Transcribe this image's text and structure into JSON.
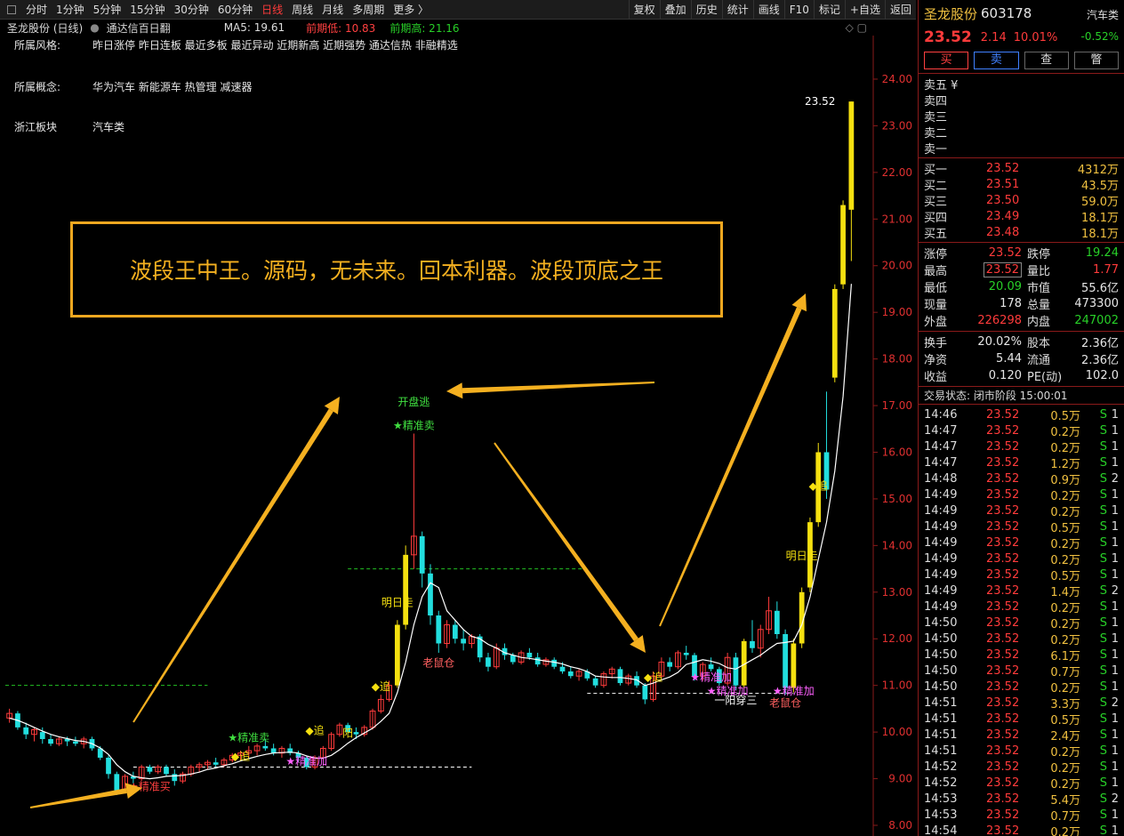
{
  "toolbar": {
    "periods": [
      "分时",
      "1分钟",
      "5分钟",
      "15分钟",
      "30分钟",
      "60分钟",
      "日线",
      "周线",
      "月线",
      "多周期",
      "更多 〉"
    ],
    "active_index": 6,
    "right": [
      "复权",
      "叠加",
      "历史",
      "统计",
      "画线",
      "F10",
      "标记",
      "+自选",
      "返回"
    ]
  },
  "info": {
    "title": "圣龙股份 (日线)",
    "indicator": "通达信百日翻",
    "ma5": "MA5: 19.61",
    "prev_low": "前期低: 10.83",
    "prev_high": "前期高: 21.16"
  },
  "tags": [
    {
      "label": "所属风格:",
      "value": "昨日涨停 昨日连板 最近多板 最近异动 近期新高 近期强势 通达信热 非融精选"
    },
    {
      "label": "所属概念:",
      "value": "华为汽车 新能源车 热管理 减速器"
    },
    {
      "label": "浙江板块",
      "value": "汽车类"
    }
  ],
  "banner": "波段王中王。源码，无未来。回本利器。波段顶底之王",
  "colors": {
    "up": "#ff3b3b",
    "down": "#22dede",
    "ma": "#ffffff",
    "signal_yellow": "#f5e010",
    "arrow": "#f4b020",
    "grid_axis": "#8a1a1a"
  },
  "chart_data": {
    "type": "candlestick",
    "ylim": [
      8.0,
      24.4
    ],
    "yticks": [
      8.0,
      9.0,
      10.0,
      11.0,
      12.0,
      13.0,
      14.0,
      15.0,
      16.0,
      17.0,
      18.0,
      19.0,
      20.0,
      21.0,
      22.0,
      23.0,
      24.0
    ],
    "candles": [
      [
        10.3,
        10.5,
        10.2,
        10.4
      ],
      [
        10.4,
        10.45,
        10.05,
        10.1
      ],
      [
        10.1,
        10.2,
        9.85,
        9.95
      ],
      [
        9.95,
        10.1,
        9.8,
        10.05
      ],
      [
        10.0,
        10.1,
        9.75,
        9.85
      ],
      [
        9.85,
        9.95,
        9.7,
        9.75
      ],
      [
        9.75,
        9.9,
        9.7,
        9.85
      ],
      [
        9.85,
        9.9,
        9.7,
        9.8
      ],
      [
        9.8,
        9.9,
        9.7,
        9.75
      ],
      [
        9.75,
        9.9,
        9.65,
        9.85
      ],
      [
        9.85,
        9.9,
        9.6,
        9.65
      ],
      [
        9.65,
        9.7,
        9.4,
        9.45
      ],
      [
        9.45,
        9.5,
        9.0,
        9.1
      ],
      [
        9.1,
        9.15,
        8.65,
        8.75
      ],
      [
        8.75,
        9.1,
        8.7,
        9.05
      ],
      [
        9.05,
        9.15,
        8.9,
        9.0
      ],
      [
        9.0,
        9.3,
        8.95,
        9.25
      ],
      [
        9.25,
        9.3,
        9.1,
        9.15
      ],
      [
        9.15,
        9.3,
        9.1,
        9.25
      ],
      [
        9.25,
        9.3,
        9.05,
        9.1
      ],
      [
        9.1,
        9.2,
        8.85,
        8.95
      ],
      [
        8.95,
        9.15,
        8.9,
        9.1
      ],
      [
        9.1,
        9.3,
        9.05,
        9.25
      ],
      [
        9.25,
        9.35,
        9.15,
        9.3
      ],
      [
        9.3,
        9.4,
        9.2,
        9.35
      ],
      [
        9.35,
        9.45,
        9.25,
        9.3
      ],
      [
        9.3,
        9.45,
        9.25,
        9.4
      ],
      [
        9.4,
        9.55,
        9.35,
        9.5
      ],
      [
        9.5,
        9.6,
        9.4,
        9.55
      ],
      [
        9.55,
        9.7,
        9.45,
        9.6
      ],
      [
        9.6,
        9.75,
        9.5,
        9.7
      ],
      [
        9.7,
        9.85,
        9.6,
        9.65
      ],
      [
        9.65,
        9.75,
        9.5,
        9.55
      ],
      [
        9.55,
        9.7,
        9.45,
        9.65
      ],
      [
        9.65,
        9.75,
        9.5,
        9.55
      ],
      [
        9.55,
        9.6,
        9.35,
        9.45
      ],
      [
        9.45,
        9.5,
        9.2,
        9.25
      ],
      [
        9.25,
        9.5,
        9.2,
        9.45
      ],
      [
        9.45,
        9.7,
        9.4,
        9.65
      ],
      [
        9.65,
        10.0,
        9.6,
        9.95
      ],
      [
        9.95,
        10.2,
        9.9,
        10.15
      ],
      [
        10.15,
        10.2,
        9.95,
        10.0
      ],
      [
        10.0,
        10.1,
        9.85,
        9.95
      ],
      [
        9.95,
        10.15,
        9.9,
        10.1
      ],
      [
        10.1,
        10.5,
        10.05,
        10.45
      ],
      [
        10.45,
        10.8,
        10.4,
        10.7
      ],
      [
        10.7,
        11.1,
        10.65,
        11.0
      ],
      [
        11.0,
        12.4,
        10.95,
        12.3
      ],
      [
        12.3,
        14.0,
        12.2,
        13.8
      ],
      [
        13.8,
        16.4,
        13.5,
        14.2
      ],
      [
        14.2,
        14.3,
        13.1,
        13.4
      ],
      [
        13.4,
        13.6,
        12.3,
        12.5
      ],
      [
        12.5,
        12.6,
        11.7,
        11.9
      ],
      [
        11.9,
        12.4,
        11.8,
        12.3
      ],
      [
        12.3,
        12.4,
        11.9,
        12.0
      ],
      [
        12.0,
        12.2,
        11.75,
        11.9
      ],
      [
        11.9,
        12.1,
        11.8,
        12.05
      ],
      [
        12.05,
        12.1,
        11.5,
        11.6
      ],
      [
        11.6,
        11.7,
        11.3,
        11.4
      ],
      [
        11.4,
        11.9,
        11.35,
        11.8
      ],
      [
        11.8,
        11.9,
        11.55,
        11.65
      ],
      [
        11.65,
        11.7,
        11.45,
        11.5
      ],
      [
        11.5,
        11.75,
        11.45,
        11.7
      ],
      [
        11.7,
        11.8,
        11.55,
        11.6
      ],
      [
        11.6,
        11.7,
        11.4,
        11.45
      ],
      [
        11.45,
        11.6,
        11.4,
        11.55
      ],
      [
        11.55,
        11.6,
        11.35,
        11.4
      ],
      [
        11.4,
        11.5,
        11.25,
        11.3
      ],
      [
        11.3,
        11.4,
        11.15,
        11.2
      ],
      [
        11.2,
        11.35,
        11.1,
        11.3
      ],
      [
        11.3,
        11.35,
        11.1,
        11.15
      ],
      [
        11.15,
        11.2,
        10.95,
        11.0
      ],
      [
        11.0,
        11.3,
        10.95,
        11.25
      ],
      [
        11.25,
        11.4,
        11.15,
        11.35
      ],
      [
        11.35,
        11.4,
        11.0,
        11.05
      ],
      [
        11.05,
        11.25,
        11.0,
        11.2
      ],
      [
        11.2,
        11.3,
        10.95,
        11.0
      ],
      [
        11.0,
        11.05,
        10.6,
        10.7
      ],
      [
        10.7,
        11.3,
        10.65,
        11.2
      ],
      [
        11.2,
        11.6,
        11.15,
        11.5
      ],
      [
        11.5,
        11.6,
        11.3,
        11.4
      ],
      [
        11.4,
        11.75,
        11.35,
        11.7
      ],
      [
        11.7,
        11.85,
        11.55,
        11.65
      ],
      [
        11.65,
        11.7,
        11.1,
        11.2
      ],
      [
        11.2,
        11.5,
        11.1,
        11.45
      ],
      [
        11.45,
        11.6,
        11.3,
        11.35
      ],
      [
        11.35,
        11.4,
        11.0,
        11.05
      ],
      [
        11.05,
        11.7,
        11.0,
        11.6
      ],
      [
        11.6,
        11.7,
        10.9,
        11.0
      ],
      [
        11.0,
        12.0,
        10.95,
        11.95
      ],
      [
        11.95,
        12.4,
        11.7,
        11.8
      ],
      [
        11.8,
        12.3,
        11.6,
        12.2
      ],
      [
        12.2,
        12.9,
        12.1,
        12.6
      ],
      [
        12.6,
        12.8,
        12.0,
        12.1
      ],
      [
        12.1,
        12.2,
        10.8,
        10.95
      ],
      [
        10.95,
        12.0,
        10.85,
        11.9
      ],
      [
        11.9,
        13.1,
        11.8,
        13.0
      ],
      [
        13.1,
        14.6,
        13.0,
        14.5
      ],
      [
        14.5,
        16.2,
        14.4,
        16.0
      ],
      [
        16.0,
        17.3,
        15.0,
        15.2
      ],
      [
        17.6,
        19.6,
        17.5,
        19.5
      ],
      [
        19.6,
        21.4,
        19.5,
        21.3
      ],
      [
        21.2,
        23.52,
        20.1,
        23.52
      ]
    ],
    "ma5": [
      10.3,
      10.25,
      10.18,
      10.1,
      10.02,
      9.95,
      9.9,
      9.86,
      9.82,
      9.8,
      9.75,
      9.66,
      9.52,
      9.3,
      9.15,
      9.05,
      9.02,
      9.0,
      9.02,
      9.05,
      9.06,
      9.07,
      9.1,
      9.14,
      9.2,
      9.23,
      9.28,
      9.32,
      9.38,
      9.43,
      9.48,
      9.52,
      9.55,
      9.56,
      9.57,
      9.55,
      9.49,
      9.44,
      9.44,
      9.5,
      9.62,
      9.76,
      9.88,
      9.98,
      10.08,
      10.23,
      10.4,
      10.85,
      11.5,
      12.3,
      12.9,
      13.2,
      13.1,
      12.6,
      12.4,
      12.2,
      12.05,
      12.0,
      11.88,
      11.8,
      11.7,
      11.65,
      11.6,
      11.58,
      11.55,
      11.52,
      11.5,
      11.46,
      11.4,
      11.36,
      11.3,
      11.2,
      11.18,
      11.17,
      11.17,
      11.15,
      11.12,
      11.0,
      11.05,
      11.12,
      11.18,
      11.28,
      11.45,
      11.5,
      11.55,
      11.52,
      11.47,
      11.38,
      11.35,
      11.45,
      11.55,
      11.65,
      11.78,
      11.9,
      11.92,
      11.95,
      12.3,
      12.9,
      13.7,
      14.5,
      15.6,
      17.2,
      19.61
    ],
    "ref_lines": [
      {
        "label": "prev_high",
        "value": 13.5,
        "from": 41,
        "to": 70
      },
      {
        "label": "prev_low",
        "value": 10.83,
        "from": 70,
        "to": 95
      },
      {
        "label": "base",
        "value": 9.25,
        "from": 15,
        "to": 56
      }
    ],
    "annotations": [
      {
        "text": "开盘逃",
        "i": 49,
        "price": 17.0,
        "color": "#40e040"
      },
      {
        "text": "★精准卖",
        "i": 49,
        "price": 16.5,
        "color": "#40e040"
      },
      {
        "text": "明日走",
        "i": 47,
        "price": 12.7,
        "color": "#f5e010"
      },
      {
        "text": "◆追",
        "i": 45,
        "price": 10.9,
        "color": "#f5e010"
      },
      {
        "text": "老鼠仓",
        "i": 52,
        "price": 11.4,
        "color": "#ff6060"
      },
      {
        "text": "★精准卖",
        "i": 29,
        "price": 9.8,
        "color": "#40e040"
      },
      {
        "text": "◆追",
        "i": 28,
        "price": 9.4,
        "color": "#f5e010"
      },
      {
        "text": "◆追",
        "i": 37,
        "price": 9.95,
        "color": "#f5e010"
      },
      {
        "text": "阳",
        "i": 41,
        "price": 9.9,
        "color": "#f5e010"
      },
      {
        "text": "★精准加",
        "i": 36,
        "price": 9.3,
        "color": "#ff60ff"
      },
      {
        "text": "★精准买",
        "i": 17,
        "price": 8.75,
        "color": "#ff4040"
      },
      {
        "text": "◆追",
        "i": 78,
        "price": 11.1,
        "color": "#f5e010"
      },
      {
        "text": "★精准加",
        "i": 85,
        "price": 11.1,
        "color": "#ff60ff"
      },
      {
        "text": "★精准加",
        "i": 87,
        "price": 10.8,
        "color": "#ff60ff"
      },
      {
        "text": "一阳穿三",
        "i": 88,
        "price": 10.6,
        "color": "#ffffff"
      },
      {
        "text": "★精准加",
        "i": 95,
        "price": 10.8,
        "color": "#ff60ff"
      },
      {
        "text": "老鼠仓",
        "i": 94,
        "price": 10.55,
        "color": "#ff6060"
      },
      {
        "text": "明日走",
        "i": 96,
        "price": 13.7,
        "color": "#f5e010"
      },
      {
        "text": "◆追",
        "i": 98,
        "price": 15.2,
        "color": "#f5e010"
      }
    ],
    "last_price_label": "23.52"
  },
  "side": {
    "name": "圣龙股份",
    "code": "603178",
    "industry": "汽车类",
    "industry_pct": "-0.52%",
    "price": "23.52",
    "change": "2.14",
    "pct": "10.01%",
    "buttons": [
      "买",
      "卖",
      "查",
      "瞥"
    ],
    "asks": [
      {
        "l": "卖五 ¥",
        "p": "",
        "v": ""
      },
      {
        "l": "卖四",
        "p": "",
        "v": ""
      },
      {
        "l": "卖三",
        "p": "",
        "v": ""
      },
      {
        "l": "卖二",
        "p": "",
        "v": ""
      },
      {
        "l": "卖一",
        "p": "",
        "v": ""
      }
    ],
    "bids": [
      {
        "l": "买一",
        "p": "23.52",
        "v": "4312万"
      },
      {
        "l": "买二",
        "p": "23.51",
        "v": "43.5万"
      },
      {
        "l": "买三",
        "p": "23.50",
        "v": "59.0万"
      },
      {
        "l": "买四",
        "p": "23.49",
        "v": "18.1万"
      },
      {
        "l": "买五",
        "p": "23.48",
        "v": "18.1万"
      }
    ],
    "stats1": [
      {
        "l1": "涨停",
        "v1": "23.52",
        "c1": "red",
        "l2": "跌停",
        "v2": "19.24",
        "c2": "green"
      },
      {
        "l1": "最高",
        "v1": "23.52",
        "c1": "red boxed",
        "l2": "量比",
        "v2": "1.77",
        "c2": "red"
      },
      {
        "l1": "最低",
        "v1": "20.09",
        "c1": "green",
        "l2": "市值",
        "v2": "55.6亿",
        "c2": "wht"
      },
      {
        "l1": "现量",
        "v1": "178",
        "c1": "wht",
        "l2": "总量",
        "v2": "473300",
        "c2": "wht"
      },
      {
        "l1": "外盘",
        "v1": "226298",
        "c1": "red",
        "l2": "内盘",
        "v2": "247002",
        "c2": "green"
      }
    ],
    "stats2": [
      {
        "l1": "换手",
        "v1": "20.02%",
        "c1": "wht",
        "l2": "股本",
        "v2": "2.36亿",
        "c2": "wht"
      },
      {
        "l1": "净资",
        "v1": "5.44",
        "c1": "wht",
        "l2": "流通",
        "v2": "2.36亿",
        "c2": "wht"
      },
      {
        "l1": "收益",
        "v1": "0.120",
        "c1": "wht",
        "l2": "PE(动)",
        "v2": "102.0",
        "c2": "wht"
      }
    ],
    "status": "交易状态: 闭市阶段 15:00:01",
    "trades": [
      {
        "t": "14:46",
        "p": "23.52",
        "v": "0.5万",
        "s": "S",
        "n": "1"
      },
      {
        "t": "14:47",
        "p": "23.52",
        "v": "0.2万",
        "s": "S",
        "n": "1"
      },
      {
        "t": "14:47",
        "p": "23.52",
        "v": "0.2万",
        "s": "S",
        "n": "1"
      },
      {
        "t": "14:47",
        "p": "23.52",
        "v": "1.2万",
        "s": "S",
        "n": "1"
      },
      {
        "t": "14:48",
        "p": "23.52",
        "v": "0.9万",
        "s": "S",
        "n": "2"
      },
      {
        "t": "14:49",
        "p": "23.52",
        "v": "0.2万",
        "s": "S",
        "n": "1"
      },
      {
        "t": "14:49",
        "p": "23.52",
        "v": "0.2万",
        "s": "S",
        "n": "1"
      },
      {
        "t": "14:49",
        "p": "23.52",
        "v": "0.5万",
        "s": "S",
        "n": "1"
      },
      {
        "t": "14:49",
        "p": "23.52",
        "v": "0.2万",
        "s": "S",
        "n": "1"
      },
      {
        "t": "14:49",
        "p": "23.52",
        "v": "0.2万",
        "s": "S",
        "n": "1"
      },
      {
        "t": "14:49",
        "p": "23.52",
        "v": "0.5万",
        "s": "S",
        "n": "1"
      },
      {
        "t": "14:49",
        "p": "23.52",
        "v": "1.4万",
        "s": "S",
        "n": "2"
      },
      {
        "t": "14:49",
        "p": "23.52",
        "v": "0.2万",
        "s": "S",
        "n": "1"
      },
      {
        "t": "14:50",
        "p": "23.52",
        "v": "0.2万",
        "s": "S",
        "n": "1"
      },
      {
        "t": "14:50",
        "p": "23.52",
        "v": "0.2万",
        "s": "S",
        "n": "1"
      },
      {
        "t": "14:50",
        "p": "23.52",
        "v": "6.1万",
        "s": "S",
        "n": "1"
      },
      {
        "t": "14:50",
        "p": "23.52",
        "v": "0.7万",
        "s": "S",
        "n": "1"
      },
      {
        "t": "14:50",
        "p": "23.52",
        "v": "0.2万",
        "s": "S",
        "n": "1"
      },
      {
        "t": "14:51",
        "p": "23.52",
        "v": "3.3万",
        "s": "S",
        "n": "2"
      },
      {
        "t": "14:51",
        "p": "23.52",
        "v": "0.5万",
        "s": "S",
        "n": "1"
      },
      {
        "t": "14:51",
        "p": "23.52",
        "v": "2.4万",
        "s": "S",
        "n": "1"
      },
      {
        "t": "14:51",
        "p": "23.52",
        "v": "0.2万",
        "s": "S",
        "n": "1"
      },
      {
        "t": "14:52",
        "p": "23.52",
        "v": "0.2万",
        "s": "S",
        "n": "1"
      },
      {
        "t": "14:52",
        "p": "23.52",
        "v": "0.2万",
        "s": "S",
        "n": "1"
      },
      {
        "t": "14:53",
        "p": "23.52",
        "v": "5.4万",
        "s": "S",
        "n": "2"
      },
      {
        "t": "14:53",
        "p": "23.52",
        "v": "0.7万",
        "s": "S",
        "n": "1"
      },
      {
        "t": "14:54",
        "p": "23.52",
        "v": "0.2万",
        "s": "S",
        "n": "1"
      }
    ]
  }
}
